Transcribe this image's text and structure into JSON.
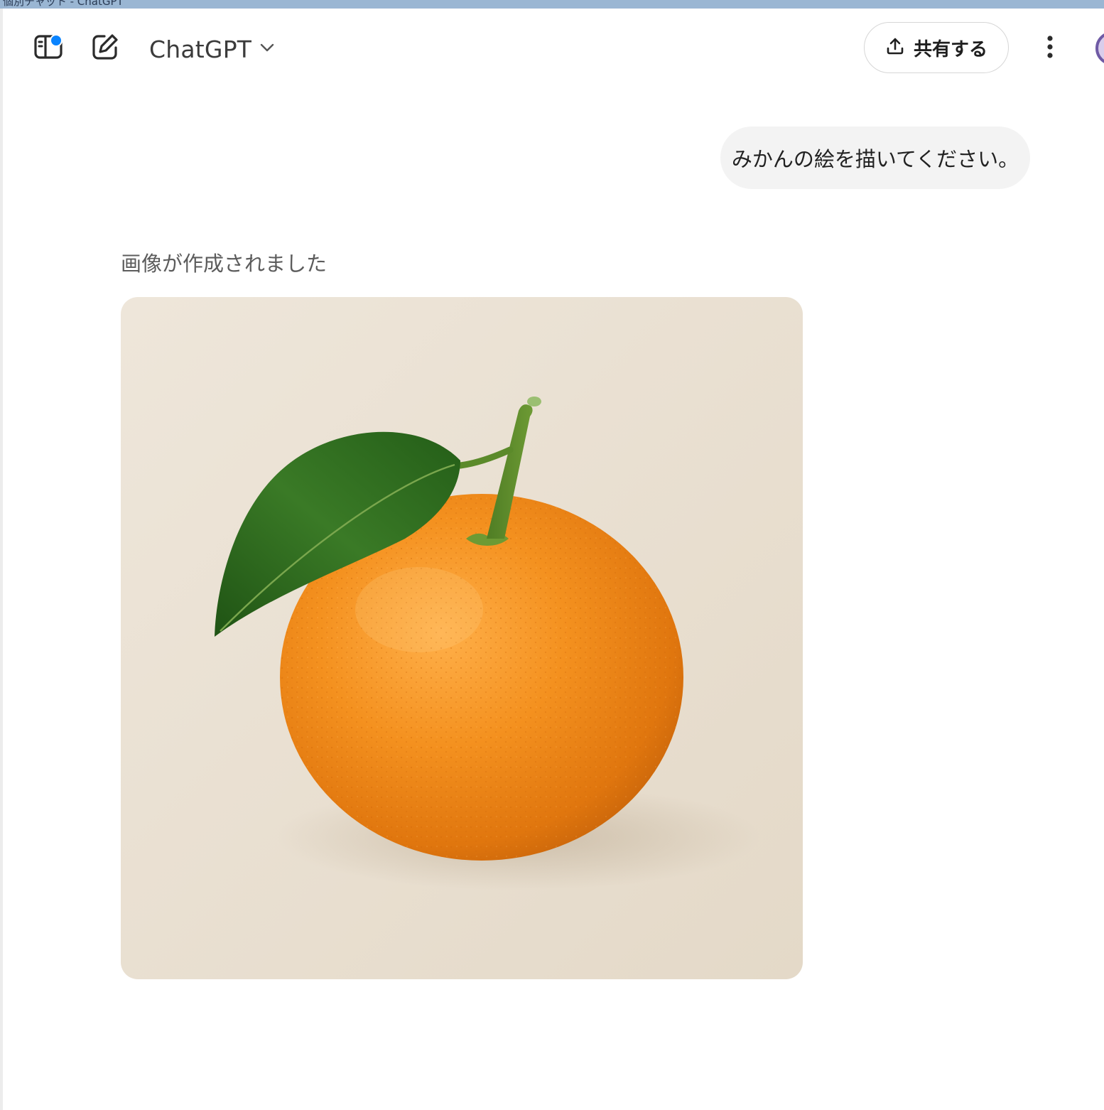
{
  "window": {
    "title_strip_text": "個別チャット - ChatGPT"
  },
  "header": {
    "model_name": "ChatGPT",
    "share_label": "共有する",
    "icons": {
      "sidebar": "sidebar-toggle-icon",
      "new_chat": "new-chat-icon",
      "model_dropdown": "chevron-down-icon",
      "share": "share-upload-icon",
      "more": "more-vertical-icon"
    },
    "notification_badge_color": "#0a84ff"
  },
  "conversation": {
    "user_message": "みかんの絵を描いてください。",
    "assistant_status": "画像が作成されました",
    "generated_image": {
      "subject": "mandarin orange with leaf",
      "alt": "mandarin orange illustration"
    }
  },
  "colors": {
    "accent_blue": "#0a84ff",
    "bubble_bg": "#f3f3f3",
    "orange": "#f08a1c",
    "leaf_green": "#2f6e1f",
    "image_bg": "#ece3d6"
  }
}
